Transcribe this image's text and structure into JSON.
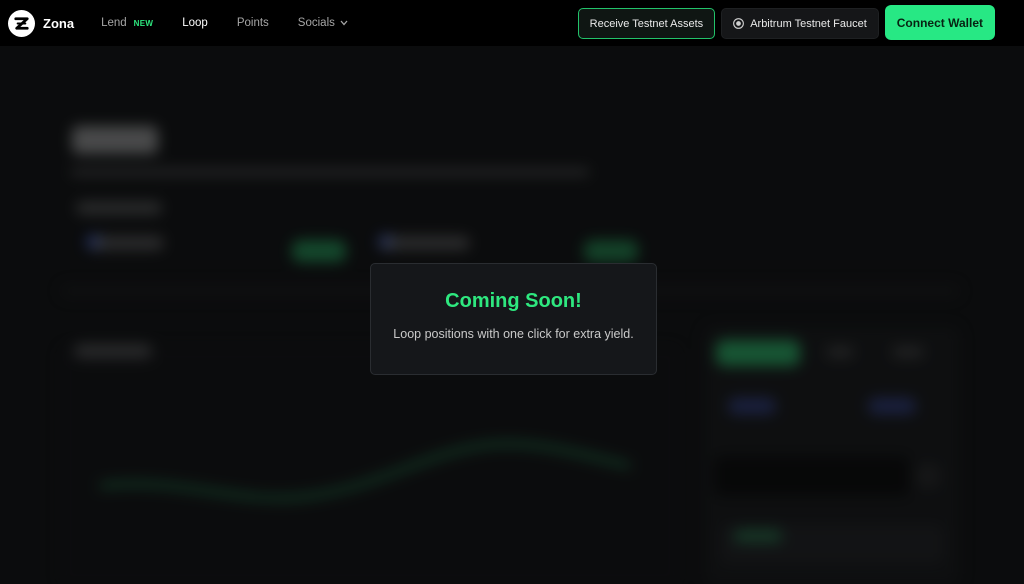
{
  "brand": {
    "name": "Zona",
    "logo_icon": "zona-logo-icon"
  },
  "nav": {
    "items": [
      {
        "label": "Lend",
        "badge": "NEW"
      },
      {
        "label": "Loop"
      },
      {
        "label": "Points"
      },
      {
        "label": "Socials"
      }
    ],
    "active": "Loop"
  },
  "actions": {
    "receive_testnet": "Receive Testnet Assets",
    "faucet": "Arbitrum Testnet Faucet",
    "connect_wallet": "Connect Wallet"
  },
  "modal": {
    "title": "Coming Soon!",
    "text": "Loop positions with one click for extra yield."
  },
  "colors": {
    "accent": "#2ee87f",
    "background": "#0b0c0d",
    "navbar": "#000000",
    "modal": "#15171a"
  }
}
